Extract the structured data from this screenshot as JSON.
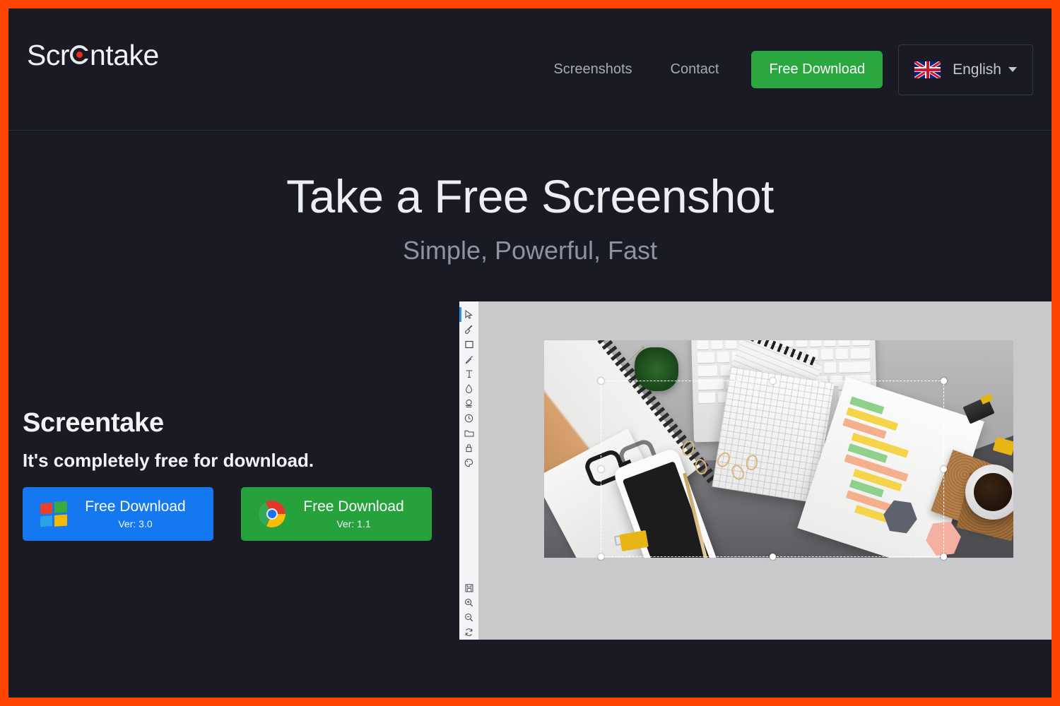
{
  "theme": {
    "page_bg": "#191A23",
    "outer_border": "#FF4500",
    "accent_green": "#2AA83F",
    "accent_blue": "#1479F0",
    "logo_dot": "#EE2B18"
  },
  "header": {
    "logo_text_before": "Scr",
    "logo_text_after": "ntake",
    "logo_full": "Screentake",
    "nav": [
      {
        "label": "Screenshots"
      },
      {
        "label": "Contact"
      }
    ],
    "cta_label": "Free Download",
    "language": {
      "label": "English",
      "flag": "uk-flag-icon"
    }
  },
  "hero": {
    "title": "Take a Free Screenshot",
    "subtitle": "Simple, Powerful, Fast"
  },
  "promo": {
    "title": "Screentake",
    "subtitle": "It's completely free for download.",
    "buttons": [
      {
        "platform_icon": "windows-logo-icon",
        "label": "Free Download",
        "version": "Ver: 3.0",
        "color": "#1479F0"
      },
      {
        "platform_icon": "chrome-logo-icon",
        "label": "Free Download",
        "version": "Ver: 1.1",
        "color": "#25A23B"
      }
    ]
  },
  "editor": {
    "tools": [
      {
        "name": "cursor-tool",
        "active": true
      },
      {
        "name": "brush-tool",
        "active": false
      },
      {
        "name": "rectangle-tool",
        "active": false
      },
      {
        "name": "eyedropper-tool",
        "active": false
      },
      {
        "name": "text-tool",
        "active": false
      },
      {
        "name": "droplet-tool",
        "active": false
      },
      {
        "name": "stamp-tool",
        "active": false
      },
      {
        "name": "clock-tool",
        "active": false
      },
      {
        "name": "folder-tool",
        "active": false
      },
      {
        "name": "lock-tool",
        "active": false
      },
      {
        "name": "palette-tool",
        "active": false
      }
    ],
    "bottom_tools": [
      {
        "name": "save-tool"
      },
      {
        "name": "zoom-in-tool"
      },
      {
        "name": "zoom-out-tool"
      },
      {
        "name": "refresh-tool"
      }
    ],
    "canvas": {
      "image_description": "desk-flatlay-photo",
      "selection_active": true,
      "handle_count": 8
    }
  }
}
